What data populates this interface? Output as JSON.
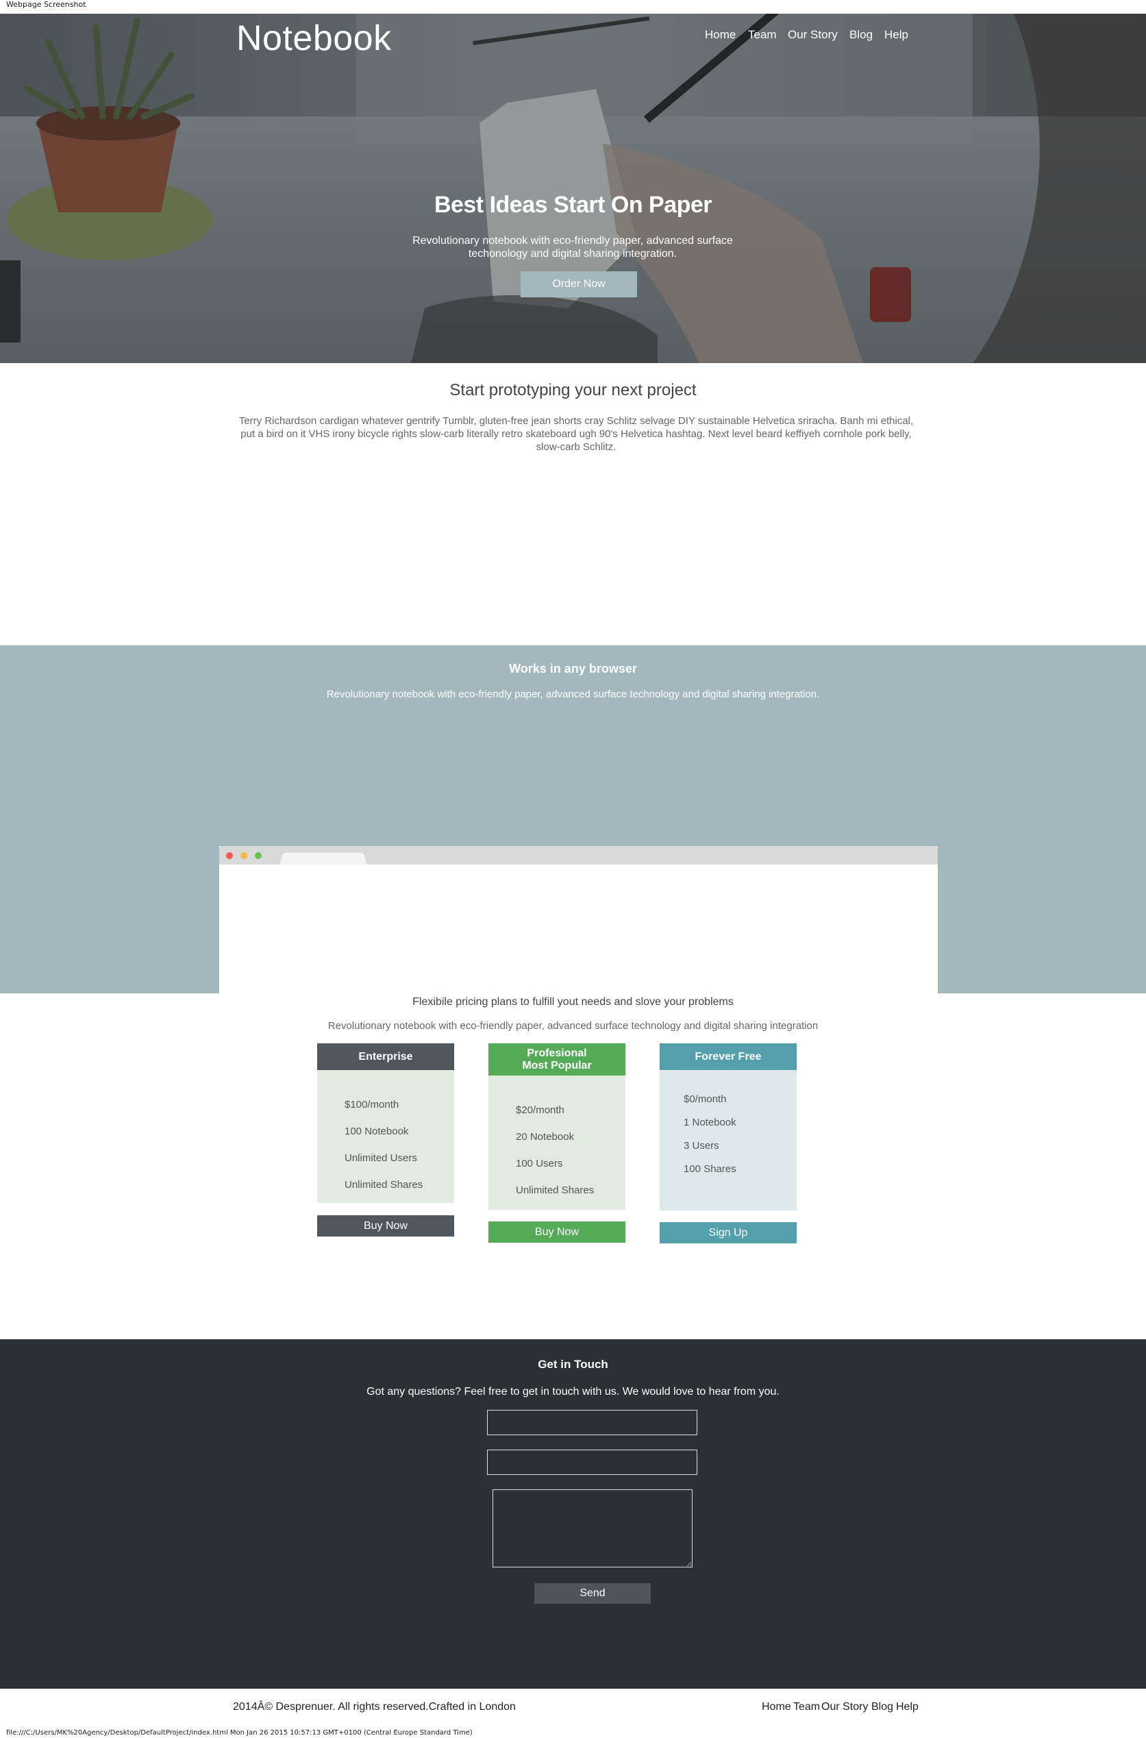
{
  "print": {
    "header_text": "Webpage Screenshot",
    "footer_text": "file:///C:/Users/MK%20Agency/Desktop/DefaultProject/index.html Mon Jan 26 2015 10:57:13 GMT+0100 (Central Europe Standard Time)"
  },
  "header": {
    "logo": "Notebook",
    "nav": [
      "Home",
      "Team",
      "Our Story",
      "Blog",
      "Help"
    ]
  },
  "hero": {
    "title": "Best Ideas Start On Paper",
    "subtitle": "Revolutionary notebook with eco-friendly paper, advanced surface techonology and digital sharing integration.",
    "cta": "Order Now"
  },
  "prototype": {
    "title": "Start prototyping your next project",
    "text": "Terry Richardson cardigan whatever gentrify Tumblr, gluten-free jean shorts cray Schlitz selvage DIY sustainable Helvetica sriracha. Banh mi ethical, put a bird on it VHS irony bicycle rights slow-carb literally retro skateboard ugh 90's Helvetica hashtag. Next level beard keffiyeh cornhole pork belly, slow-carb Schlitz."
  },
  "browser": {
    "title": "Works in any browser",
    "subtitle": "Revolutionary notebook with eco-friendly paper, advanced surface technology and digital sharing integration.",
    "dot_colors": [
      "#f05a4f",
      "#f5b942",
      "#6bc24b"
    ]
  },
  "pricing": {
    "title": "Flexibile pricing plans to fulfill yout needs and slove your problems",
    "subtitle": "Revolutionary notebook with eco-friendly paper, advanced surface technology and digital sharing integration",
    "plans": [
      {
        "name": "Enterprise",
        "features": [
          "$100/month",
          "100 Notebook",
          "Unlimited Users",
          "Unlimited Shares"
        ],
        "button": "Buy Now",
        "header_color": "#50575c",
        "body_color": "#e1ebe0",
        "button_color": "#50575c"
      },
      {
        "name_line1": "Profesional",
        "name_line2": "Most Popular",
        "features": [
          "$20/month",
          "20 Notebook",
          "100 Users",
          "Unlimited Shares"
        ],
        "button": "Buy Now",
        "header_color": "#54aa56",
        "body_color": "#e1ebe0",
        "button_color": "#54aa56"
      },
      {
        "name": "Forever Free",
        "features": [
          "$0/month",
          "1 Notebook",
          "3 Users",
          "100 Shares"
        ],
        "button": "Sign Up",
        "header_color": "#539fab",
        "body_color": "#dfe9ec",
        "button_color": "#539fab"
      }
    ]
  },
  "contact": {
    "title": "Get in Touch",
    "subtitle": "Got any questions? Feel free to get in touch with us. We would love to hear from you.",
    "send": "Send"
  },
  "footer": {
    "copyright": "2014Â© Desprenuer. All rights reserved.Crafted in London",
    "nav": [
      "Home",
      "Team",
      "Our Story",
      "Blog",
      "Help"
    ]
  }
}
